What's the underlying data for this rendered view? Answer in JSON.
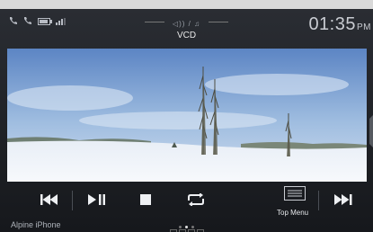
{
  "status": {
    "source": "VCD",
    "time": "01:35",
    "ampm": "PM",
    "icons": [
      "phone-icon",
      "phone-icon",
      "battery-icon",
      "signal-icon"
    ],
    "center_icons": [
      "audio-icon",
      "media-icon"
    ]
  },
  "video": {
    "scene": "winter-field-poplar-trees"
  },
  "controls": {
    "buttons": [
      {
        "name": "previous-track",
        "icon": "prev-icon"
      },
      {
        "name": "play-pause",
        "icon": "play-pause-icon"
      },
      {
        "name": "stop",
        "icon": "stop-icon"
      },
      {
        "name": "repeat",
        "icon": "repeat-icon"
      },
      {
        "name": "top-menu",
        "icon": "menu-icon",
        "label": "Top Menu"
      },
      {
        "name": "next-track",
        "icon": "next-icon"
      }
    ],
    "top_menu_label": "Top Menu"
  },
  "bottom": {
    "device_name": "Alpine iPhone",
    "page_count": 3,
    "active_page": 1
  },
  "colors": {
    "background": "#1e2126",
    "text": "#e8e8e8",
    "muted": "#aeb3ba"
  }
}
